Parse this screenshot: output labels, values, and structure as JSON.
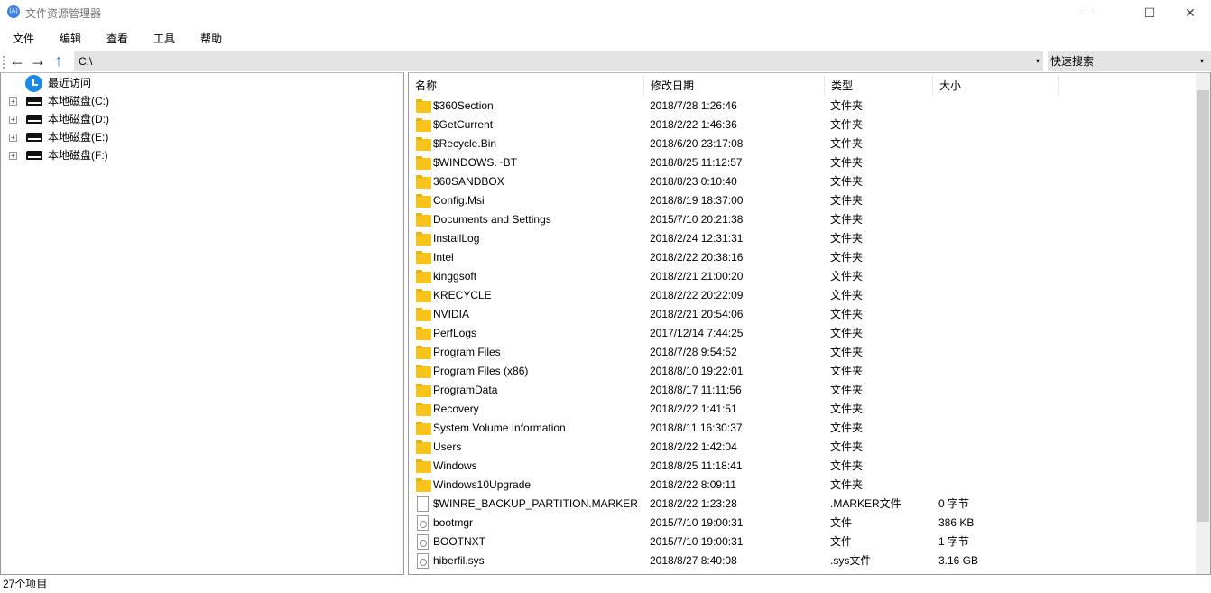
{
  "window": {
    "title": "文件资源管理器",
    "icon": "app-logo-icon",
    "minimize": "—",
    "maximize": "☐",
    "close": "✕"
  },
  "menu": [
    "文件",
    "编辑",
    "查看",
    "工具",
    "帮助"
  ],
  "toolbar": {
    "back": "←",
    "forward": "→",
    "up": "↑",
    "address": "C:\\",
    "search_placeholder": "快速搜索",
    "dropdown": "▾"
  },
  "tree": [
    {
      "label": "最近访问",
      "icon": "clock-icon"
    },
    {
      "label": "本地磁盘(C:)",
      "icon": "drive-icon"
    },
    {
      "label": "本地磁盘(D:)",
      "icon": "drive-icon"
    },
    {
      "label": "本地磁盘(E:)",
      "icon": "drive-icon"
    },
    {
      "label": "本地磁盘(F:)",
      "icon": "drive-icon"
    }
  ],
  "columns": [
    "名称",
    "修改日期",
    "类型",
    "大小"
  ],
  "files": [
    [
      "$360Section",
      "2018/7/28 1:26:46",
      "文件夹",
      "",
      "folder"
    ],
    [
      "$GetCurrent",
      "2018/2/22 1:46:36",
      "文件夹",
      "",
      "folder"
    ],
    [
      "$Recycle.Bin",
      "2018/6/20 23:17:08",
      "文件夹",
      "",
      "folder"
    ],
    [
      "$WINDOWS.~BT",
      "2018/8/25 11:12:57",
      "文件夹",
      "",
      "folder"
    ],
    [
      "360SANDBOX",
      "2018/8/23 0:10:40",
      "文件夹",
      "",
      "folder"
    ],
    [
      "Config.Msi",
      "2018/8/19 18:37:00",
      "文件夹",
      "",
      "folder"
    ],
    [
      "Documents and Settings",
      "2015/7/10 20:21:38",
      "文件夹",
      "",
      "folder"
    ],
    [
      "InstallLog",
      "2018/2/24 12:31:31",
      "文件夹",
      "",
      "folder"
    ],
    [
      "Intel",
      "2018/2/22 20:38:16",
      "文件夹",
      "",
      "folder"
    ],
    [
      "kinggsoft",
      "2018/2/21 21:00:20",
      "文件夹",
      "",
      "folder"
    ],
    [
      "KRECYCLE",
      "2018/2/22 20:22:09",
      "文件夹",
      "",
      "folder"
    ],
    [
      "NVIDIA",
      "2018/2/21 20:54:06",
      "文件夹",
      "",
      "folder"
    ],
    [
      "PerfLogs",
      "2017/12/14 7:44:25",
      "文件夹",
      "",
      "folder"
    ],
    [
      "Program Files",
      "2018/7/28 9:54:52",
      "文件夹",
      "",
      "folder"
    ],
    [
      "Program Files (x86)",
      "2018/8/10 19:22:01",
      "文件夹",
      "",
      "folder"
    ],
    [
      "ProgramData",
      "2018/8/17 11:11:56",
      "文件夹",
      "",
      "folder"
    ],
    [
      "Recovery",
      "2018/2/22 1:41:51",
      "文件夹",
      "",
      "folder"
    ],
    [
      "System Volume Information",
      "2018/8/11 16:30:37",
      "文件夹",
      "",
      "folder"
    ],
    [
      "Users",
      "2018/2/22 1:42:04",
      "文件夹",
      "",
      "folder"
    ],
    [
      "Windows",
      "2018/8/25 11:18:41",
      "文件夹",
      "",
      "folder"
    ],
    [
      "Windows10Upgrade",
      "2018/2/22 8:09:11",
      "文件夹",
      "",
      "folder"
    ],
    [
      "$WINRE_BACKUP_PARTITION.MARKER",
      "2018/2/22 1:23:28",
      ".MARKER文件",
      "0 字节",
      "file"
    ],
    [
      "bootmgr",
      "2015/7/10 19:00:31",
      "文件",
      "386 KB",
      "sys"
    ],
    [
      "BOOTNXT",
      "2015/7/10 19:00:31",
      "文件",
      "1 字节",
      "sys"
    ],
    [
      "hiberfil.sys",
      "2018/8/27 8:40:08",
      ".sys文件",
      "3.16 GB",
      "sys"
    ]
  ],
  "status": "27个项目",
  "colors": {
    "accent": "#1e88e5",
    "folder": "#f8c41a",
    "toolbar_bg": "#e3e3e3"
  }
}
